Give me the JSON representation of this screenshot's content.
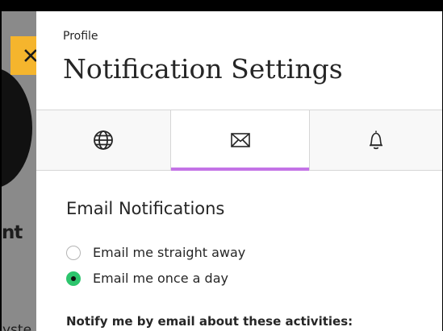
{
  "background": {
    "partial_heading": "nt",
    "partial_text": "yste"
  },
  "close_button": {
    "icon": "close-icon",
    "color": "#f5b52d"
  },
  "breadcrumb": "Profile",
  "title": "Notification Settings",
  "tabs": [
    {
      "icon": "globe-icon",
      "selected": false
    },
    {
      "icon": "envelope-icon",
      "selected": true
    },
    {
      "icon": "bell-icon",
      "selected": false
    }
  ],
  "accent_color": "#c373e6",
  "section": {
    "title": "Email Notifications",
    "options": [
      {
        "label": "Email me straight away",
        "checked": false
      },
      {
        "label": "Email me once a day",
        "checked": true
      }
    ],
    "notify_label": "Notify me by email about these activities:"
  }
}
